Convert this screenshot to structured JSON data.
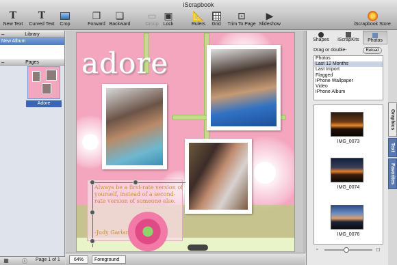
{
  "app": {
    "title": "iScrapbook"
  },
  "toolbar": {
    "new_text": "New Text",
    "curved_text": "Curved Text",
    "crop": "Crop",
    "forward": "Forward",
    "backward": "Backward",
    "group": "Group",
    "lock": "Lock",
    "rulers": "Rulers",
    "grid": "Grid",
    "trim_to_page": "Trim To Page",
    "slideshow": "Slideshow",
    "store": "iScrapbook Store"
  },
  "sidebar": {
    "library_header": "Library",
    "album": "New Album",
    "pages_header": "Pages",
    "page_label": "Adore"
  },
  "canvas": {
    "title_text": "adore",
    "quote": "Always be a first-rate version of yourself, instead of a second-rate version of someone else.",
    "author": "-Judy Garland"
  },
  "status": {
    "zoom": "64%",
    "layer": "Foreground",
    "page_of": "Page 1 of 1"
  },
  "right_panel": {
    "tabs": [
      "Shapes",
      "iScrapKits",
      "Photos"
    ],
    "drag_label": "Drag or double-",
    "reload": "Reload",
    "sources": [
      "Photos",
      "Last 12 Months",
      "Last Import",
      "Flagged",
      "iPhone Wallpaper",
      "Video",
      "iPhone Album"
    ],
    "photos": [
      "IMG_0073",
      "IMG_0074",
      "IMG_0076"
    ]
  },
  "side_tabs": [
    "Graphics",
    "Text",
    "Favorites"
  ],
  "colors": {
    "page_pink": "#f4a6bf",
    "accent_blue": "#3a66b0",
    "quote_gold": "#c98c3e"
  }
}
